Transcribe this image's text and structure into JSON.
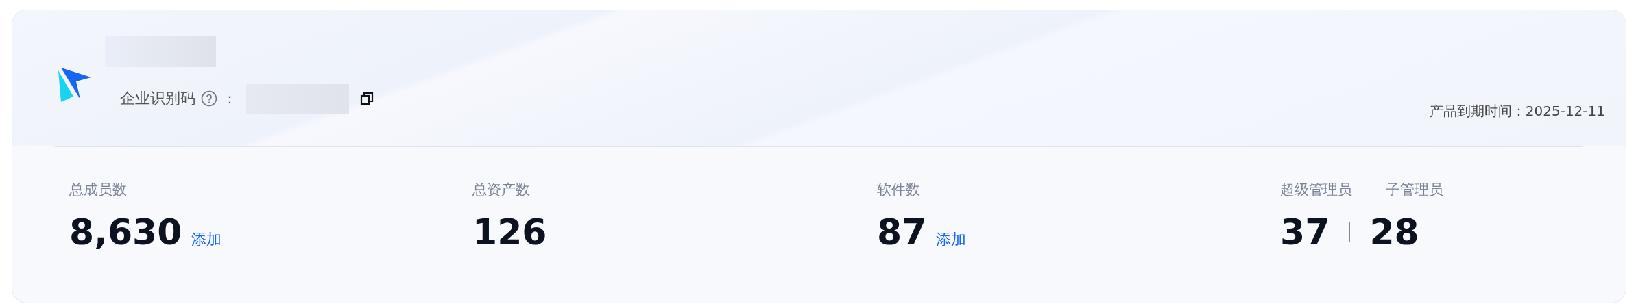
{
  "company": {
    "id_label": "企业识别码",
    "id_colon": "：",
    "expiry": "产品到期时间：2025-12-11"
  },
  "stats": [
    {
      "kind": "single",
      "label": "总成员数",
      "value": "8,630",
      "action": "添加"
    },
    {
      "kind": "single",
      "label": "总资产数",
      "value": "126"
    },
    {
      "kind": "single",
      "label": "软件数",
      "value": "87",
      "action": "添加"
    },
    {
      "kind": "pair",
      "labels": [
        "超级管理员",
        "子管理员"
      ],
      "values": [
        "37",
        "28"
      ]
    }
  ]
}
